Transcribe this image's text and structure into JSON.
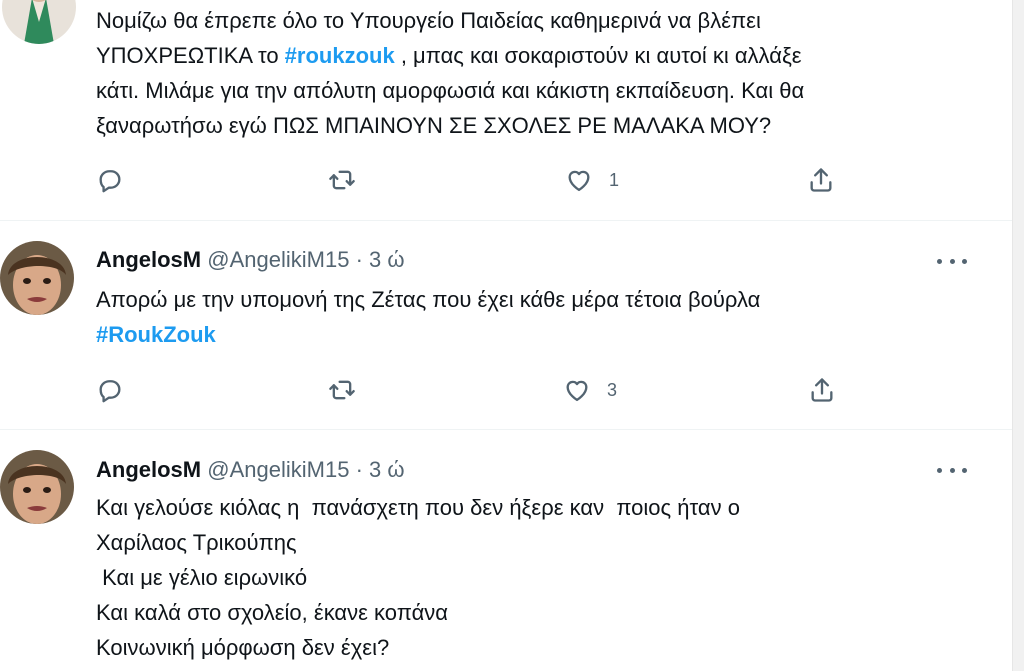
{
  "tweets": [
    {
      "lines": [
        [
          "Νομίζω θα έπρεπε όλο το Υπουργείο Παιδείας καθημερινά να βλέπει"
        ],
        [
          "ΥΠΟΧΡΕΩΤΙΚΑ το ",
          "#roukzouk",
          " , μπας και σοκαριστούν κι αυτοί κι αλλάξε"
        ],
        [
          "κάτι. Μιλάμε για την απόλυτη αμορφωσιά και κάκιστη εκπαίδευση. Και θα"
        ],
        [
          "ξαναρωτήσω εγώ ΠΩΣ ΜΠΑΙΝΟΥΝ ΣΕ ΣΧΟΛΕΣ ΡΕ ΜΑΛΑΚΑ ΜΟΥ?"
        ]
      ],
      "like_count": "1"
    },
    {
      "name": "AngelosM",
      "handle": "@AngelikiM15",
      "dot": "·",
      "time": "3 ώ",
      "lines": [
        [
          "Απορώ με την υπομονή της Ζέτας που έχει κάθε μέρα τέτοια βούρλα"
        ],
        [
          "",
          "#RoukZouk",
          ""
        ]
      ],
      "like_count": "3"
    },
    {
      "name": "AngelosM",
      "handle": "@AngelikiM15",
      "dot": "·",
      "time": "3 ώ",
      "lines": [
        [
          "Και γελούσε κιόλας η  πανάσχετη που δεν ήξερε καν  ποιος ήταν ο"
        ],
        [
          "Χαρίλαος Τρικούπης"
        ],
        [
          " Και με γέλιο ειρωνικό"
        ],
        [
          "Και καλά στο σχολείο, έκανε κοπάνα"
        ],
        [
          "Κοινωνική μόρφωση δεν έχει?"
        ]
      ]
    }
  ],
  "icons": {
    "reply": "reply-icon",
    "retweet": "retweet-icon",
    "like": "like-icon",
    "share": "share-icon",
    "more": "more-icon"
  },
  "colors": {
    "hashtag": "#1d9bf0",
    "secondary_text": "#536471",
    "divider": "#eff3f4"
  }
}
